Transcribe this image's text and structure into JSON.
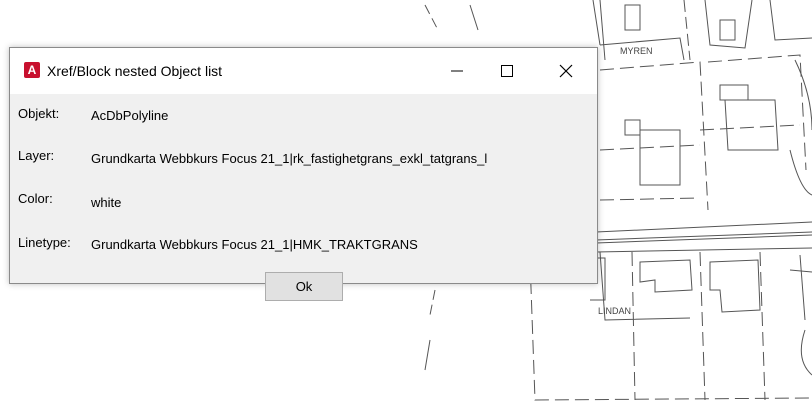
{
  "map": {
    "labels": [
      "MYREN",
      "LINDAN"
    ]
  },
  "dialog": {
    "title": "Xref/Block nested Object list",
    "icon": "autocad-app-icon",
    "icon_glyph": "A",
    "icon_color": "#c8102e",
    "controls": {
      "minimize": "minimize-icon",
      "maximize": "maximize-icon",
      "close": "close-icon"
    },
    "fields": {
      "objekt_label": "Objekt:",
      "objekt_value": "AcDbPolyline",
      "layer_label": "Layer:",
      "layer_value": "Grundkarta Webbkurs Focus 21_1|rk_fastighetgrans_exkl_tatgrans_l",
      "color_label": "Color:",
      "color_value": "white",
      "linetype_label": "Linetype:",
      "linetype_value": "Grundkarta Webbkurs Focus 21_1|HMK_TRAKTGRANS"
    },
    "ok_label": "Ok"
  }
}
